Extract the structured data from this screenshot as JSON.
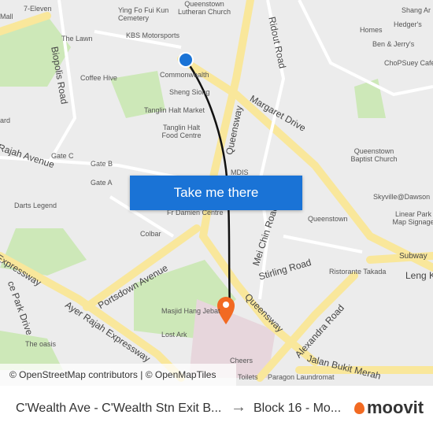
{
  "map": {
    "labels": [
      "7-Eleven",
      "Ying Fo Fui Kun Cemetery",
      "Queenstown Lutheran Church",
      "KBS Motorsports",
      "The Lawn",
      "Coffee Hive",
      "Commonwealth",
      "Sheng Siong",
      "Tanglin Halt Market",
      "Tanglin Halt Food Centre",
      "Homes",
      "Hedger's",
      "Shang Ar",
      "Ben & Jerry's",
      "ChoPSuey Café",
      "Queenstown Baptist Church",
      "Skyville@Dawson",
      "Linear Park Map Signage",
      "Gate C",
      "Gate B",
      "Gate A",
      "Darts Legend",
      "MDIS",
      "Fr Damien Centre",
      "Colbar",
      "Queenstown",
      "Ristorante Takada",
      "Masjid Hang Jebat",
      "Lost Ark",
      "The oasis",
      "Cheers",
      "Toilets",
      "Paragon Laundromat",
      "Mall",
      "ard"
    ],
    "roads": [
      "Queensway",
      "Ridout Road",
      "Margaret Drive",
      "Biopolis Road",
      "Rajah Avenue",
      "Portsdown Avenue",
      "Ayer Rajah Expressway",
      "Expressway",
      "Mei Chin Road",
      "Stirling Road",
      "Queensway",
      "Alexandra Road",
      "Jalan Bukit Merah",
      "Leng Kee",
      "Subway",
      "ce Park Drive"
    ],
    "colors": {
      "road_major": "#f9e79b",
      "park": "#cde8b8",
      "route": "#111111",
      "origin": "#1a73d6",
      "destination": "#f26a22",
      "button": "#1a73d6"
    }
  },
  "cta_label": "Take me there",
  "attribution": "© OpenStreetMap contributors | © OpenMapTiles",
  "footer": {
    "from": "C'Wealth Ave - C'Wealth Stn Exit B...",
    "arrow": "→",
    "to": "Block 16 - Mo...",
    "brand": "moovit"
  }
}
